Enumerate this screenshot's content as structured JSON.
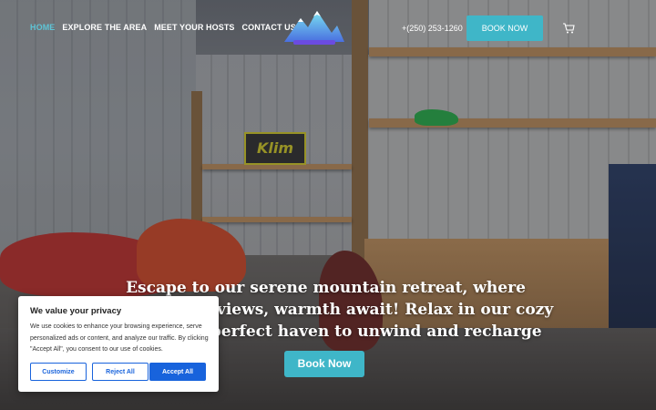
{
  "nav": {
    "items": [
      {
        "label": "HOME",
        "active": true
      },
      {
        "label": "EXPLORE THE AREA",
        "active": false
      },
      {
        "label": "MEET YOUR HOSTS",
        "active": false
      },
      {
        "label": "CONTACT US",
        "active": false
      }
    ]
  },
  "header": {
    "phone": "+(250) 253-1260",
    "book_label": "BOOK NOW",
    "logo_icon": "mountain-logo-icon",
    "cart_icon": "cart-icon"
  },
  "hero": {
    "sign_text": "Klim",
    "headline": "Escape to our serene mountain retreat, where breathtaking views, warmth await! Relax in our cozy cabins, the perfect haven to unwind and recharge",
    "button_label": "Book Now"
  },
  "cookie": {
    "title": "We value your privacy",
    "body": "We use cookies to enhance your browsing experience, serve personalized ads or content, and analyze our traffic. By clicking \"Accept All\", you consent to our use of cookies.",
    "customize": "Customize",
    "reject": "Reject All",
    "accept": "Accept All"
  },
  "colors": {
    "accent": "#3fb6c8",
    "nav_active": "#5ec4d6",
    "cookie_primary": "#1863dc"
  }
}
